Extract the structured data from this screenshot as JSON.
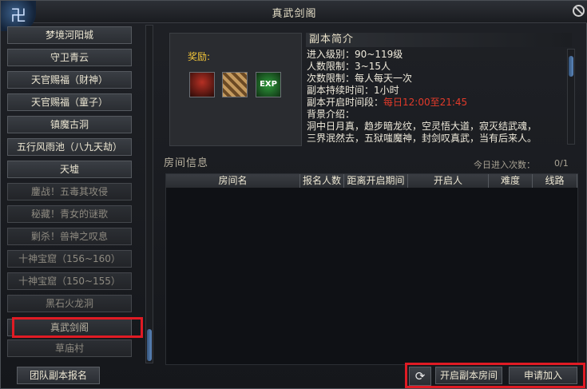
{
  "window": {
    "title": "真武剑阁"
  },
  "dungeon_list": [
    {
      "label": "梦境河阳城",
      "state": "normal"
    },
    {
      "label": "守卫青云",
      "state": "normal"
    },
    {
      "label": "天官赐福（财神）",
      "state": "normal"
    },
    {
      "label": "天官赐福（童子）",
      "state": "normal"
    },
    {
      "label": "镇魔古洞",
      "state": "normal"
    },
    {
      "label": "五行风雨池（八九天劫）",
      "state": "normal"
    },
    {
      "label": "天墟",
      "state": "normal"
    },
    {
      "label": "鏖战！五毒其攻侵",
      "state": "dim"
    },
    {
      "label": "秘藏！青女的谜歌",
      "state": "dim"
    },
    {
      "label": "剿杀！兽神之叹息",
      "state": "dim"
    },
    {
      "label": "十神宝窟（156~160）",
      "state": "dim"
    },
    {
      "label": "十神宝窟（150~155）",
      "state": "dim"
    },
    {
      "label": "黑石火龙洞",
      "state": "dim"
    },
    {
      "label": "真武剑阁",
      "state": "selected"
    },
    {
      "label": "草庙村",
      "state": "dim"
    }
  ],
  "team_signup_button": "团队副本报名",
  "reward": {
    "label": "奖励:",
    "items": [
      "weapon-icon",
      "claw-icon",
      "exp-icon"
    ],
    "exp_text": "EXP"
  },
  "intro": {
    "header": "副本简介",
    "level_range": "进入级别：90~119级",
    "player_limit": "人数限制：3~15人",
    "count_limit": "次数限制：每人每天一次",
    "duration": "副本持续时间：1小时",
    "open_time_label": "副本开启时间段：",
    "open_time_value": "每日12:00至21:45",
    "background_label": "背景介绍：",
    "background_line1": "洞中日月真，趋步暗龙纹，空灵悟大道，寂灭结武魂，",
    "background_line2": "三界泯然去，五狱嗤魔神，封剑叹真武，当有后来人。"
  },
  "room_info": {
    "title": "房间信息",
    "today_entries_label": "今日进入次数：",
    "today_entries_value": "0/1",
    "columns": [
      "房间名",
      "报名人数",
      "距离开启期间",
      "开启人",
      "难度",
      "线路"
    ]
  },
  "buttons": {
    "open_room": "开启副本房间",
    "apply_join": "申请加入",
    "refresh_glyph": "⟳"
  },
  "colors": {
    "highlight": "#e01b24",
    "reward_label": "#f3c63a",
    "open_time": "#e23a2a"
  }
}
